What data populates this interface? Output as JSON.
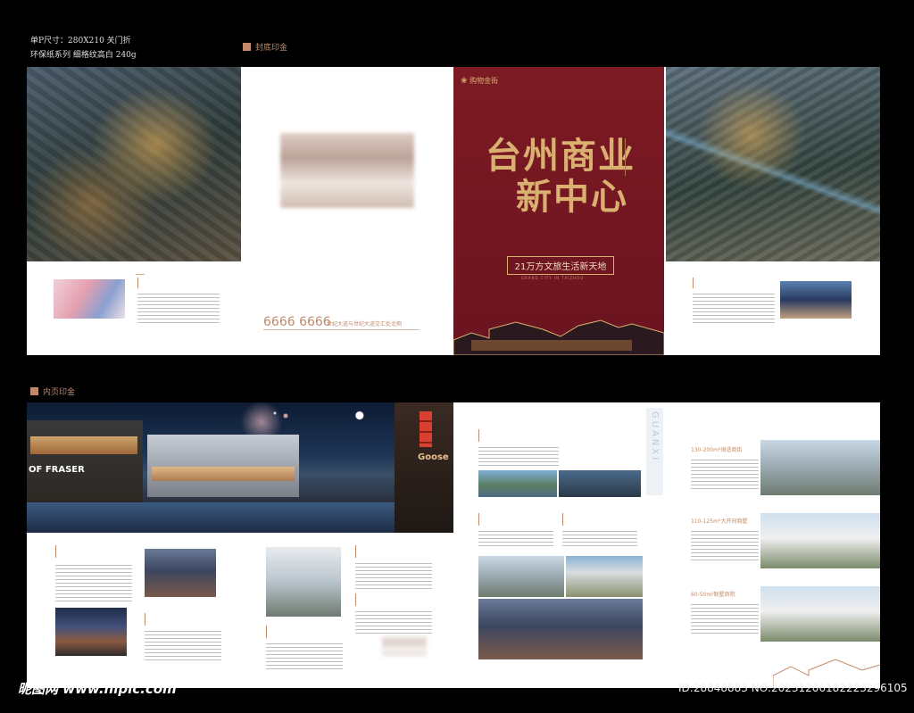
{
  "spec": {
    "line1": "单P尺寸：280X210      关门折",
    "line2": "环保纸系列  细格纹高白        240g"
  },
  "sections": {
    "cover_tag": "封底印金",
    "inner_tag": "内页印金"
  },
  "cover": {
    "logo": "购物金街",
    "title_line1": "台州商业",
    "title_line2": "新中心",
    "subtitle": "21万方文旅生活新天地",
    "small_en": "GRAND  CITY  IN  TAIZHOU"
  },
  "back": {
    "phone": "6666 6666",
    "address": "世纪大道与世纪大道交汇处北侧"
  },
  "inner": {
    "vertical_en": "GUANXI",
    "spec1": "130-200m²阔适商街",
    "spec2": "110-125m²大开间商墅",
    "spec3": "60-50m²联墅商院",
    "goose": "Goose",
    "fraser": "OF FRASER"
  },
  "footer": {
    "site": "昵图网 www.nipic.com",
    "id": "ID:28848883 NO:20231206182223296105"
  },
  "colors": {
    "accent": "#c08a6a",
    "cover_red": "#7d1a24",
    "gold": "#d9b070"
  }
}
